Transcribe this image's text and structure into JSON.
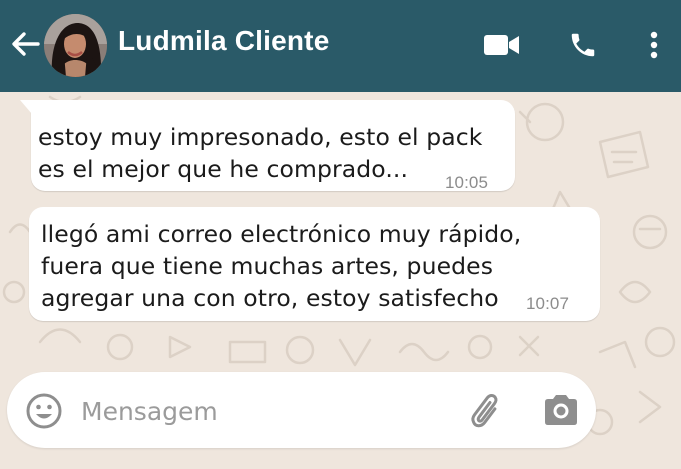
{
  "header": {
    "contact_name": "Ludmila Cliente",
    "background_color": "#2a5a68",
    "icons": {
      "back": "arrow-left-icon",
      "video": "video-camera-icon",
      "call": "phone-icon",
      "menu": "more-vertical-icon"
    }
  },
  "messages": [
    {
      "lines": [
        "estoy muy impresonado, esto el pack",
        "es el mejor que he comprado..."
      ],
      "time": "10:05"
    },
    {
      "lines": [
        "llegó ami correo electrónico muy rápido,",
        "fuera que tiene muchas artes, puedes",
        "agregar una con otro, estoy satisfecho"
      ],
      "time": "10:07"
    }
  ],
  "composer": {
    "placeholder": "Mensagem",
    "value": "",
    "icons": {
      "emoji": "emoji-icon",
      "attach": "paperclip-icon",
      "camera": "camera-icon"
    }
  },
  "colors": {
    "chat_background": "#efe6dd",
    "bubble": "#ffffff",
    "timestamp": "#8c8c8c"
  }
}
